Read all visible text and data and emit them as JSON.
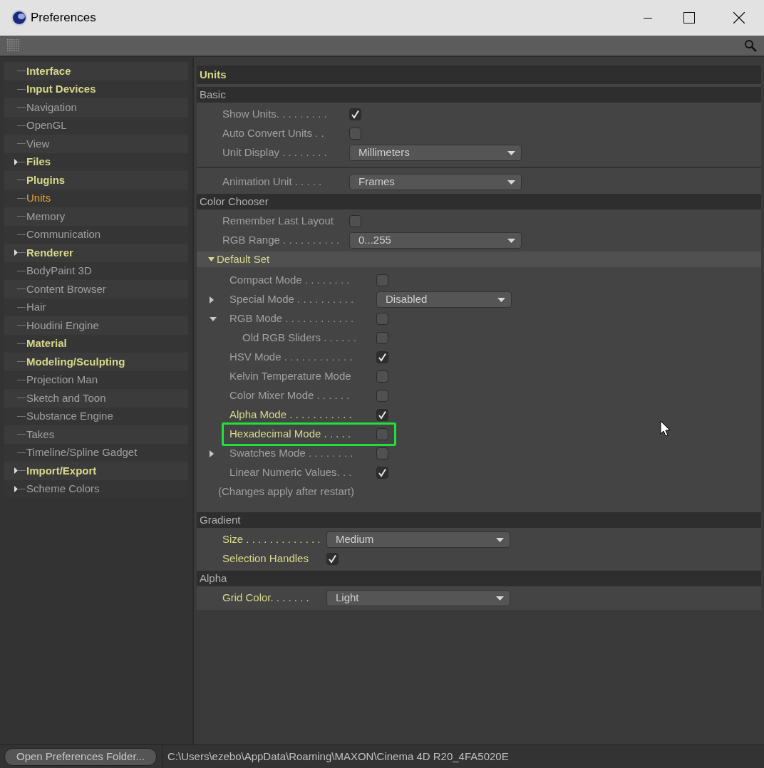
{
  "window": {
    "title": "Preferences"
  },
  "sidebar": {
    "items": [
      {
        "label": "Interface",
        "modified": true,
        "selected": false,
        "has_children": false
      },
      {
        "label": "Input Devices",
        "modified": true,
        "selected": false,
        "has_children": false
      },
      {
        "label": "Navigation",
        "modified": false,
        "selected": false,
        "has_children": false
      },
      {
        "label": "OpenGL",
        "modified": false,
        "selected": false,
        "has_children": false
      },
      {
        "label": "View",
        "modified": false,
        "selected": false,
        "has_children": false
      },
      {
        "label": "Files",
        "modified": true,
        "selected": false,
        "has_children": true
      },
      {
        "label": "Plugins",
        "modified": true,
        "selected": false,
        "has_children": false
      },
      {
        "label": "Units",
        "modified": false,
        "selected": true,
        "has_children": false
      },
      {
        "label": "Memory",
        "modified": false,
        "selected": false,
        "has_children": false
      },
      {
        "label": "Communication",
        "modified": false,
        "selected": false,
        "has_children": false
      },
      {
        "label": "Renderer",
        "modified": true,
        "selected": false,
        "has_children": true
      },
      {
        "label": "BodyPaint 3D",
        "modified": false,
        "selected": false,
        "has_children": false
      },
      {
        "label": "Content Browser",
        "modified": false,
        "selected": false,
        "has_children": false
      },
      {
        "label": "Hair",
        "modified": false,
        "selected": false,
        "has_children": false
      },
      {
        "label": "Houdini Engine",
        "modified": false,
        "selected": false,
        "has_children": false
      },
      {
        "label": "Material",
        "modified": true,
        "selected": false,
        "has_children": false
      },
      {
        "label": "Modeling/Sculpting",
        "modified": true,
        "selected": false,
        "has_children": false
      },
      {
        "label": "Projection Man",
        "modified": false,
        "selected": false,
        "has_children": false
      },
      {
        "label": "Sketch and Toon",
        "modified": false,
        "selected": false,
        "has_children": false
      },
      {
        "label": "Substance Engine",
        "modified": false,
        "selected": false,
        "has_children": false
      },
      {
        "label": "Takes",
        "modified": false,
        "selected": false,
        "has_children": false
      },
      {
        "label": "Timeline/Spline Gadget",
        "modified": false,
        "selected": false,
        "has_children": false
      },
      {
        "label": "Import/Export",
        "modified": true,
        "selected": false,
        "has_children": true
      },
      {
        "label": "Scheme Colors",
        "modified": false,
        "selected": false,
        "has_children": true
      }
    ]
  },
  "panel": {
    "title": "Units",
    "sections": [
      {
        "title": "Basic",
        "rows": [
          {
            "kind": "checkbox",
            "label": "Show Units. . . . . . . . .",
            "modified": false,
            "checked": true
          },
          {
            "kind": "checkbox",
            "label": "Auto Convert Units . .",
            "modified": false,
            "checked": false
          },
          {
            "kind": "dropdown",
            "label": "Unit Display . . . . . . . .",
            "modified": false,
            "value": "Millimeters"
          },
          {
            "kind": "divider"
          },
          {
            "kind": "dropdown",
            "label": "Animation Unit . . . . .",
            "modified": false,
            "value": "Frames"
          }
        ]
      },
      {
        "title": "Color Chooser",
        "rows": [
          {
            "kind": "checkbox",
            "label": "Remember Last Layout",
            "modified": false,
            "checked": false
          },
          {
            "kind": "dropdown",
            "label": "RGB Range . . . . . . . . . .",
            "modified": false,
            "value": "0...255"
          },
          {
            "kind": "group",
            "label": "Default Set",
            "expanded": true,
            "children": [
              {
                "kind": "checkbox",
                "label": "Compact Mode . . . . . . . .",
                "modified": false,
                "checked": false,
                "expandable": false,
                "highlighted": false
              },
              {
                "kind": "dropdown",
                "label": "Special Mode . . . . . . . . . .",
                "modified": false,
                "value": "Disabled",
                "expandable": true,
                "expanded": false,
                "highlighted": false
              },
              {
                "kind": "checkbox",
                "label": "RGB Mode . . . . . . . . . . . .",
                "modified": false,
                "checked": false,
                "expandable": true,
                "expanded": true,
                "highlighted": false,
                "children": [
                  {
                    "kind": "checkbox",
                    "label": "Old RGB Sliders . . . . . .",
                    "modified": false,
                    "checked": false,
                    "expandable": false,
                    "highlighted": false
                  }
                ]
              },
              {
                "kind": "checkbox",
                "label": "HSV Mode . . . . . . . . . . . .",
                "modified": false,
                "checked": true,
                "expandable": false,
                "highlighted": false
              },
              {
                "kind": "checkbox",
                "label": "Kelvin Temperature Mode",
                "modified": false,
                "checked": false,
                "expandable": false,
                "highlighted": false
              },
              {
                "kind": "checkbox",
                "label": "Color Mixer Mode . . . . . .",
                "modified": false,
                "checked": false,
                "expandable": false,
                "highlighted": false
              },
              {
                "kind": "checkbox",
                "label": "Alpha Mode . . . . . . . . . . .",
                "modified": true,
                "checked": true,
                "expandable": false,
                "highlighted": false
              },
              {
                "kind": "checkbox",
                "label": "Hexadecimal Mode . . . . .",
                "modified": true,
                "checked": false,
                "expandable": false,
                "highlighted": true
              },
              {
                "kind": "checkbox",
                "label": "Swatches Mode . . . . . . . .",
                "modified": false,
                "checked": false,
                "expandable": true,
                "expanded": false,
                "highlighted": false
              },
              {
                "kind": "checkbox",
                "label": "Linear Numeric Values. . .",
                "modified": false,
                "checked": true,
                "expandable": false,
                "highlighted": false
              },
              {
                "kind": "note",
                "label": "(Changes apply after restart)"
              }
            ]
          }
        ]
      },
      {
        "title": "Gradient",
        "rows": [
          {
            "kind": "dropdown",
            "label": "Size . . . . . . . . . . . . .",
            "modified": true,
            "value": "Medium"
          },
          {
            "kind": "checkbox",
            "label": "Selection Handles",
            "modified": true,
            "checked": true
          }
        ]
      },
      {
        "title": "Alpha",
        "rows": [
          {
            "kind": "dropdown",
            "label": "Grid Color. . . . . . .",
            "modified": true,
            "value": "Light"
          }
        ]
      }
    ]
  },
  "status_bar": {
    "button": "Open Preferences Folder...",
    "path": "C:\\Users\\ezebo\\AppData\\Roaming\\MAXON\\Cinema 4D R20_4FA5020E"
  }
}
